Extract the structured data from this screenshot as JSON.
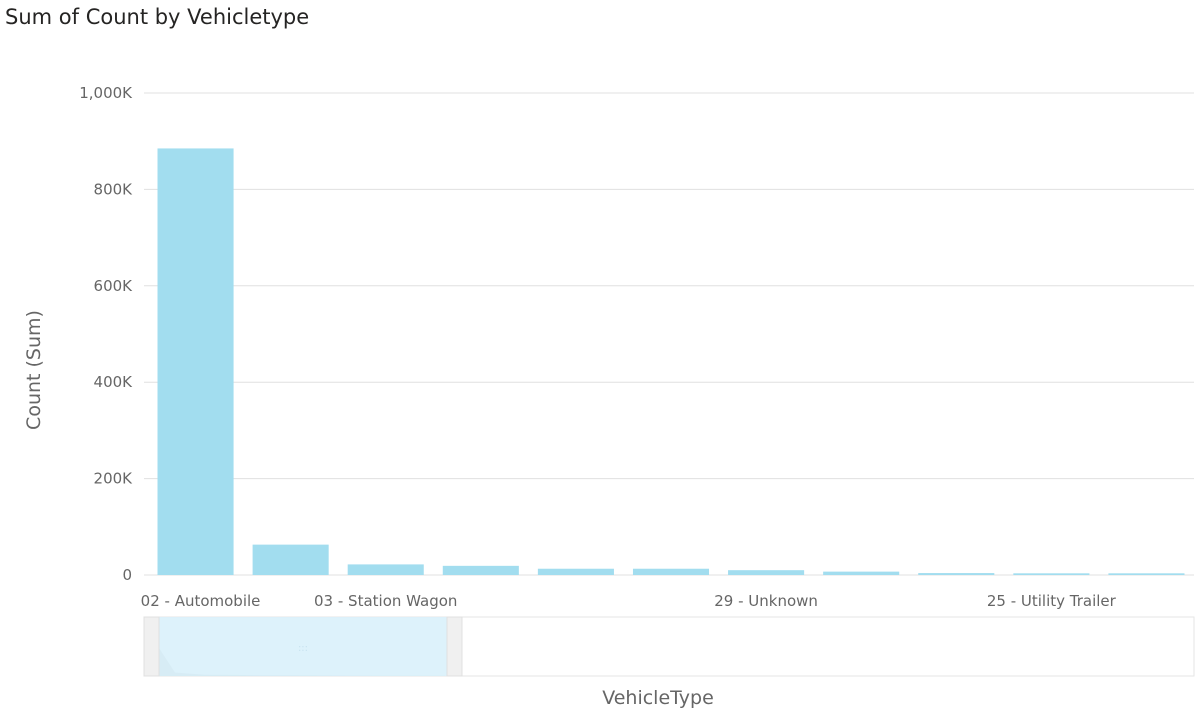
{
  "chart_data": {
    "type": "bar",
    "title": "Sum of Count by Vehicletype",
    "xlabel": "VehicleType",
    "ylabel": "Count (Sum)",
    "ylim": [
      0,
      1000000
    ],
    "yticks": [
      0,
      200000,
      400000,
      600000,
      800000,
      1000000
    ],
    "ytick_labels": [
      "0",
      "200K",
      "400K",
      "600K",
      "800K",
      "1,000K"
    ],
    "categories": [
      "02 - Automobile",
      "",
      "03 - Station Wagon",
      "",
      "",
      "",
      "29 - Unknown",
      "",
      "",
      "25 - Utility Trailer",
      ""
    ],
    "values": [
      885000,
      63000,
      22000,
      19000,
      13000,
      13000,
      10000,
      7000,
      4000,
      3500,
      3500
    ],
    "grid": true,
    "bar_color": "#a2ddef",
    "has_scroll_brush": true
  }
}
